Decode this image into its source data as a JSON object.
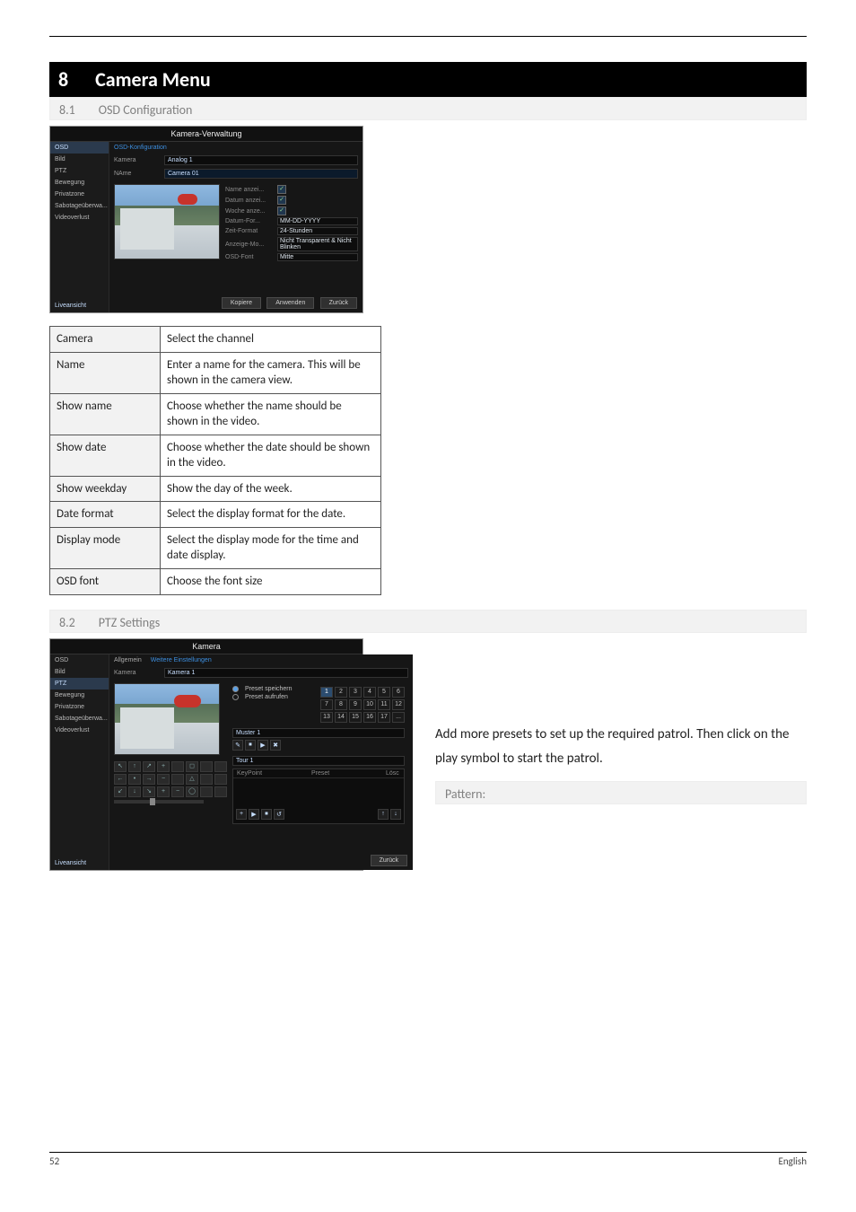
{
  "header": {
    "rule": true
  },
  "section_black": {
    "num": "8",
    "title": "Camera Menu"
  },
  "section_grey_1": {
    "num": "8.1",
    "title": "OSD Configuration"
  },
  "shot1": {
    "title": "Kamera-Verwaltung",
    "sidebar": [
      "OSD",
      "Bild",
      "PTZ",
      "Bewegung",
      "Privatzone",
      "Sabotageüberwa...",
      "Videoverlust"
    ],
    "sidebar_active_index": 0,
    "live_btn": "Liveansicht",
    "tab": "OSD-Konfiguration",
    "rows": {
      "kamera_label": "Kamera",
      "kamera_value": "Analog 1",
      "name_label": "NAme",
      "name_value": "Camera 01"
    },
    "osd_fields": [
      {
        "label": "Name anzei...",
        "type": "chk",
        "checked": true
      },
      {
        "label": "Datum anzei...",
        "type": "chk",
        "checked": true
      },
      {
        "label": "Woche anze...",
        "type": "chk",
        "checked": true
      },
      {
        "label": "Datum-For...",
        "type": "sel",
        "value": "MM-DD-YYYY"
      },
      {
        "label": "Zeit-Format",
        "type": "sel",
        "value": "24-Stunden"
      },
      {
        "label": "Anzeige-Mo...",
        "type": "sel",
        "value": "Nicht Transparent & Nicht Blinken"
      },
      {
        "label": "OSD-Font",
        "type": "sel",
        "value": "Mitte"
      }
    ],
    "buttons": [
      "Kopiere",
      "Anwenden",
      "Zurück"
    ]
  },
  "params_table": [
    {
      "k": "Camera",
      "v": "Select the channel"
    },
    {
      "k": "Name",
      "v": "Enter a name for the camera. This will be shown in the camera view."
    },
    {
      "k": "Show name",
      "v": "Choose whether the name should be shown in the video."
    },
    {
      "k": "Show date",
      "v": "Choose whether the date should be shown in the video."
    },
    {
      "k": "Show weekday",
      "v": "Show the day of the week."
    },
    {
      "k": "Date format",
      "v": "Select the display format for the date."
    },
    {
      "k": "Display mode",
      "v": "Select the display mode for the time and date display."
    },
    {
      "k": "OSD font",
      "v": "Choose the font size"
    }
  ],
  "section_grey_2": {
    "num": "8.2",
    "title": "PTZ Settings"
  },
  "shot2": {
    "title": "Kamera",
    "sidebar": [
      "OSD",
      "Bild",
      "PTZ",
      "Bewegung",
      "Privatzone",
      "Sabotageüberwa...",
      "Videoverlust"
    ],
    "sidebar_active_index": 2,
    "live_btn": "Liveansicht",
    "tabs": {
      "inactive": "Allgemein",
      "active": "Weitere Einstellungen"
    },
    "kamera_label": "Kamera",
    "kamera_value": "Kamera 1",
    "preset_save": "Preset speichern",
    "preset_call": "Preset aufrufen",
    "numbers_row1": [
      "1",
      "2",
      "3",
      "4",
      "5",
      "6"
    ],
    "numbers_row2": [
      "7",
      "8",
      "9",
      "10",
      "11",
      "12"
    ],
    "numbers_row3": [
      "13",
      "14",
      "15",
      "16",
      "17",
      "..."
    ],
    "muster_label": "Muster 1",
    "tour_label": "Tour 1",
    "table_head": [
      "KeyPoint",
      "Preset",
      "Lösc"
    ],
    "back_btn": "Zurück"
  },
  "right_column": {
    "p1": "Add more presets to set up the required patrol. Then click on the play symbol to start the patrol."
  },
  "section_grey_3": {
    "num": "",
    "title": "Pattern:"
  },
  "footer": {
    "left": "52",
    "right": "English"
  }
}
